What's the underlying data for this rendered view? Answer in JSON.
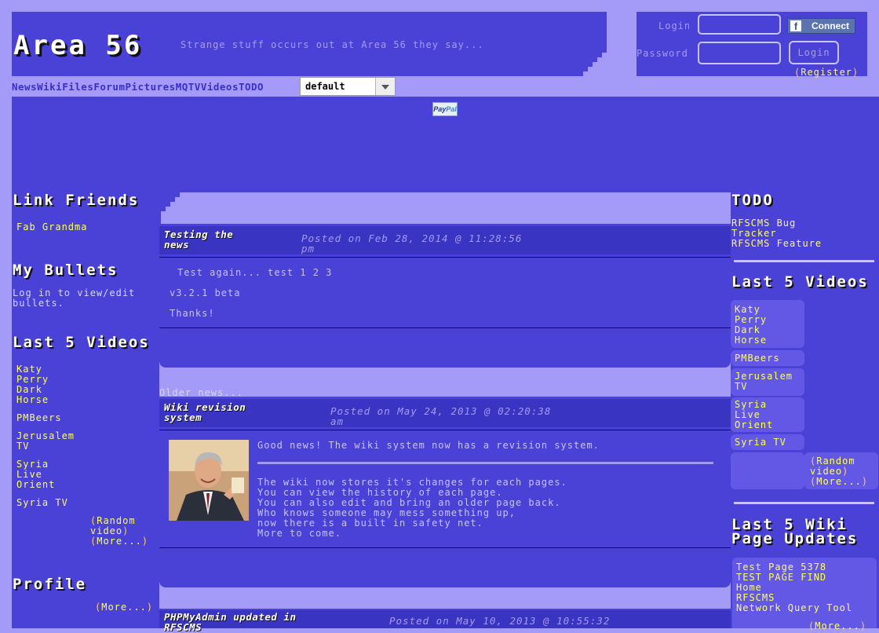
{
  "header": {
    "site_title": "Area 56",
    "tagline": "Strange stuff occurs out at Area 56 they say..."
  },
  "login": {
    "login_label": "Login",
    "password_label": "Password",
    "fb_connect_label": "Connect",
    "login_button": "Login",
    "register_link": "Register"
  },
  "nav": {
    "items": [
      "News",
      "Wiki",
      "Files",
      "Forum",
      "Pictures",
      "MQTV",
      "Videos",
      "TODO"
    ],
    "theme_select_value": "default"
  },
  "paypal": {
    "label_a": "Pay",
    "label_b": "Pal"
  },
  "left": {
    "link_friends_title": "Link Friends",
    "link_friends": [
      "Fab Grandma"
    ],
    "bullets_title": "My Bullets",
    "bullets_text_1": "Log in to view/edit",
    "bullets_text_2": "bullets.",
    "videos_title": "Last 5 Videos",
    "videos": [
      [
        "Katy",
        "Perry",
        "Dark",
        "Horse"
      ],
      [
        "PMBeers"
      ],
      [
        "Jerusalem",
        "TV"
      ],
      [
        "Syria",
        "Live",
        "Orient"
      ],
      [
        "Syria TV"
      ]
    ],
    "random_video_1": "Random",
    "random_video_2": "video",
    "more": "More...",
    "profile_title": "Profile",
    "profile_more": "More..."
  },
  "news": [
    {
      "title_1": "Testing the",
      "title_2": "news",
      "date_1": "Posted on Feb 28, 2014 @ 11:28:56",
      "date_2": "pm",
      "body": [
        "Test again... test 1 2 3",
        "v3.2.1 beta",
        "Thanks!"
      ]
    },
    {
      "title_1": "Wiki revision",
      "title_2": "system",
      "date_1": "Posted on May 24, 2013 @ 02:20:38",
      "date_2": "am",
      "intro": "Good news! The wiki system now has a revision system.",
      "body": [
        "The wiki now stores it's changes for each pages.",
        "You can view the history of each page.",
        "You can also edit and bring an older page back.",
        "Who knows someone may mess something up,",
        "now there is a built in safety net.",
        "More to come."
      ]
    },
    {
      "title_1": "PHPMyAdmin updated in",
      "title_2": "RFSCMS",
      "date_1": "Posted on May 10, 2013 @ 10:55:32"
    }
  ],
  "older_news": "Older news...",
  "right": {
    "todo_title": "TODO",
    "todo_links": [
      "RFSCMS Bug",
      "Tracker",
      "RFSCMS Feature"
    ],
    "videos_title": "Last 5 Videos",
    "videos": [
      [
        "Katy",
        "Perry",
        "Dark",
        "Horse"
      ],
      [
        "PMBeers"
      ],
      [
        "Jerusalem",
        "TV"
      ],
      [
        "Syria",
        "Live",
        "Orient"
      ],
      [
        "Syria TV"
      ]
    ],
    "random_video_1": "Random",
    "random_video_2": "video",
    "more": "More...",
    "wiki_title_1": "Last 5 Wiki",
    "wiki_title_2": "Page Updates",
    "wiki_links": [
      "Test Page 5378",
      "TEST PAGE FIND",
      "Home",
      "RFSCMS",
      "Network Query Tool"
    ],
    "wiki_more": "More..."
  }
}
